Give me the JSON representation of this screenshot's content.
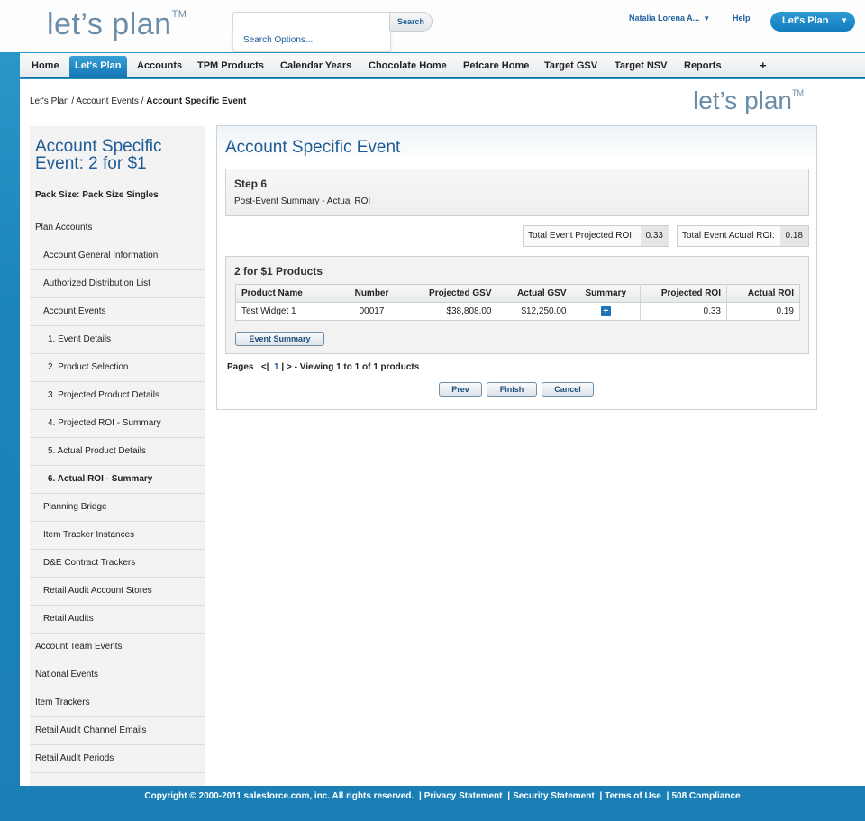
{
  "header": {
    "logo": "let’s plan",
    "logo_tm": "TM",
    "search_button": "Search",
    "search_input_value": "",
    "search_options": "Search Options...",
    "user_name": "Natalia Lorena A...",
    "help": "Help",
    "app_switcher": "Let's Plan"
  },
  "tabs": [
    {
      "label": "Home"
    },
    {
      "label": "Let's Plan"
    },
    {
      "label": "Accounts"
    },
    {
      "label": "TPM Products"
    },
    {
      "label": "Calendar Years"
    },
    {
      "label": "Chocolate Home"
    },
    {
      "label": "Petcare Home"
    },
    {
      "label": "Target GSV"
    },
    {
      "label": "Target NSV"
    },
    {
      "label": "Reports"
    }
  ],
  "tab_plus": "+",
  "breadcrumb": {
    "items": [
      "Let's Plan",
      "Account Events"
    ],
    "separator": "/",
    "current": "Account Specific Event"
  },
  "content_logo": "let’s plan",
  "sidebar": {
    "title": "Account Specific Event: 2 for $1",
    "pack_size": "Pack Size: Pack Size Singles",
    "items": [
      {
        "label": "Plan Accounts"
      },
      {
        "label": "Account General Information"
      },
      {
        "label": "Authorized Distribution List"
      },
      {
        "label": "Account Events"
      },
      {
        "label": "1. Event Details"
      },
      {
        "label": "2. Product Selection"
      },
      {
        "label": "3. Projected Product Details"
      },
      {
        "label": "4. Projected ROI - Summary"
      },
      {
        "label": "5. Actual Product Details"
      },
      {
        "label": "6. Actual ROI - Summary"
      },
      {
        "label": "Planning Bridge"
      },
      {
        "label": "Item Tracker Instances"
      },
      {
        "label": "D&E Contract Trackers"
      },
      {
        "label": "Retail Audit Account Stores"
      },
      {
        "label": "Retail Audits"
      },
      {
        "label": "Account Team Events"
      },
      {
        "label": "National Events"
      },
      {
        "label": "Item Trackers"
      },
      {
        "label": "Retail Audit Channel Emails"
      },
      {
        "label": "Retail Audit Periods"
      }
    ]
  },
  "main": {
    "title": "Account Specific Event",
    "step_title": "Step 6",
    "step_subtitle": "Post-Event Summary - Actual ROI",
    "projected_roi_label": "Total Event Projected ROI:",
    "projected_roi_value": "0.33",
    "actual_roi_label": "Total Event Actual ROI:",
    "actual_roi_value": "0.18",
    "products_title": "2 for $1 Products",
    "table": {
      "headers": [
        "Product Name",
        "Number",
        "Projected GSV",
        "Actual GSV",
        "Summary",
        "Projected ROI",
        "Actual ROI"
      ],
      "rows": [
        {
          "product_name": "Test Widget 1",
          "number": "00017",
          "projected_gsv": "$38,808.00",
          "actual_gsv": "$12,250.00",
          "summary_icon": "plus-icon",
          "projected_roi": "0.33",
          "actual_roi": "0.19"
        }
      ]
    },
    "event_summary_button": "Event Summary",
    "pager": {
      "pages_label": "Pages",
      "prev_symbol": "<",
      "sep_left": "|",
      "current_page": "1",
      "sep_right": "|",
      "next_symbol": ">",
      "viewing": "- Viewing 1 to 1 of 1 products"
    },
    "buttons": {
      "prev": "Prev",
      "finish": "Finish",
      "cancel": "Cancel"
    }
  },
  "footer": {
    "copyright": "Copyright © 2000-2011 salesforce.com, inc. All rights reserved.",
    "links": [
      "Privacy Statement",
      "Security Statement",
      "Terms of Use",
      "508 Compliance"
    ],
    "separator": "|"
  },
  "colors": {
    "brand_blue": "#1a84b8",
    "title_blue": "#1f5b95",
    "logo_gray_blue": "#6b8da8",
    "link_blue": "#1f5d9a"
  }
}
